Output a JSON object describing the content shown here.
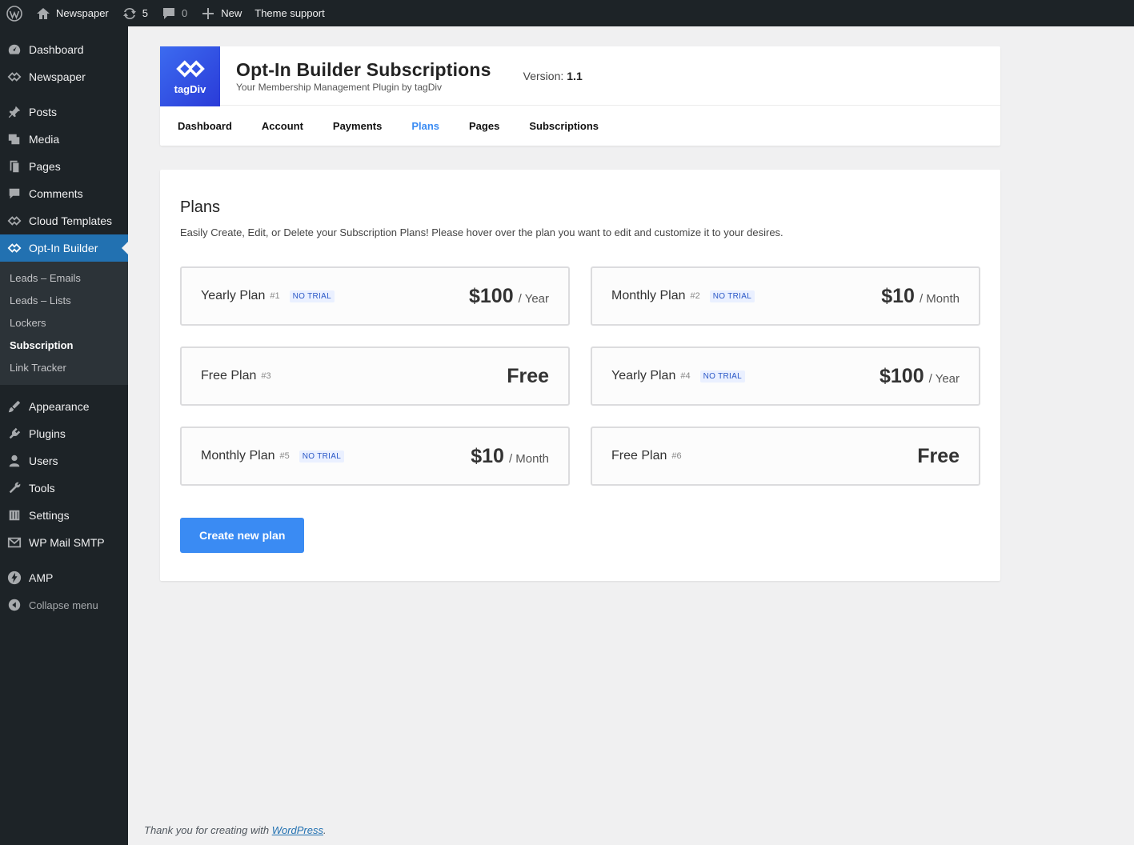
{
  "adminbar": {
    "site_name": "Newspaper",
    "updates_count": "5",
    "comments_count": "0",
    "new_label": "New",
    "theme_support": "Theme support"
  },
  "menu": {
    "dashboard": "Dashboard",
    "newspaper": "Newspaper",
    "posts": "Posts",
    "media": "Media",
    "pages": "Pages",
    "comments": "Comments",
    "cloud_templates": "Cloud Templates",
    "optin_builder": "Opt-In Builder",
    "submenu": [
      "Leads – Emails",
      "Leads – Lists",
      "Lockers",
      "Subscription",
      "Link Tracker"
    ],
    "appearance": "Appearance",
    "plugins": "Plugins",
    "users": "Users",
    "tools": "Tools",
    "settings": "Settings",
    "wp_mail_smtp": "WP Mail SMTP",
    "amp": "AMP",
    "collapse": "Collapse menu"
  },
  "header": {
    "logo_text": "tagDiv",
    "title": "Opt-In Builder Subscriptions",
    "subtitle": "Your Membership Management Plugin by tagDiv",
    "version_label": "Version:",
    "version_value": "1.1",
    "tabs": [
      "Dashboard",
      "Account",
      "Payments",
      "Plans",
      "Pages",
      "Subscriptions"
    ],
    "active_tab": "Plans"
  },
  "plans_section": {
    "heading": "Plans",
    "description": "Easily Create, Edit, or Delete your Subscription Plans! Please hover over the plan you want to edit and customize it to your desires.",
    "plans": [
      {
        "name": "Yearly Plan",
        "num": "#1",
        "badge": "NO TRIAL",
        "price": "$100",
        "period": "/ Year"
      },
      {
        "name": "Monthly Plan",
        "num": "#2",
        "badge": "NO TRIAL",
        "price": "$10",
        "period": "/ Month"
      },
      {
        "name": "Free Plan",
        "num": "#3",
        "badge": "",
        "price": "Free",
        "period": ""
      },
      {
        "name": "Yearly Plan",
        "num": "#4",
        "badge": "NO TRIAL",
        "price": "$100",
        "period": "/ Year"
      },
      {
        "name": "Monthly Plan",
        "num": "#5",
        "badge": "NO TRIAL",
        "price": "$10",
        "period": "/ Month"
      },
      {
        "name": "Free Plan",
        "num": "#6",
        "badge": "",
        "price": "Free",
        "period": ""
      }
    ],
    "create_button": "Create new plan"
  },
  "footer": {
    "text": "Thank you for creating with",
    "link": "WordPress",
    "suffix": "."
  },
  "colors": {
    "accent": "#3a8bf3",
    "admin_dark": "#1d2327",
    "menu_current": "#2271b1"
  }
}
